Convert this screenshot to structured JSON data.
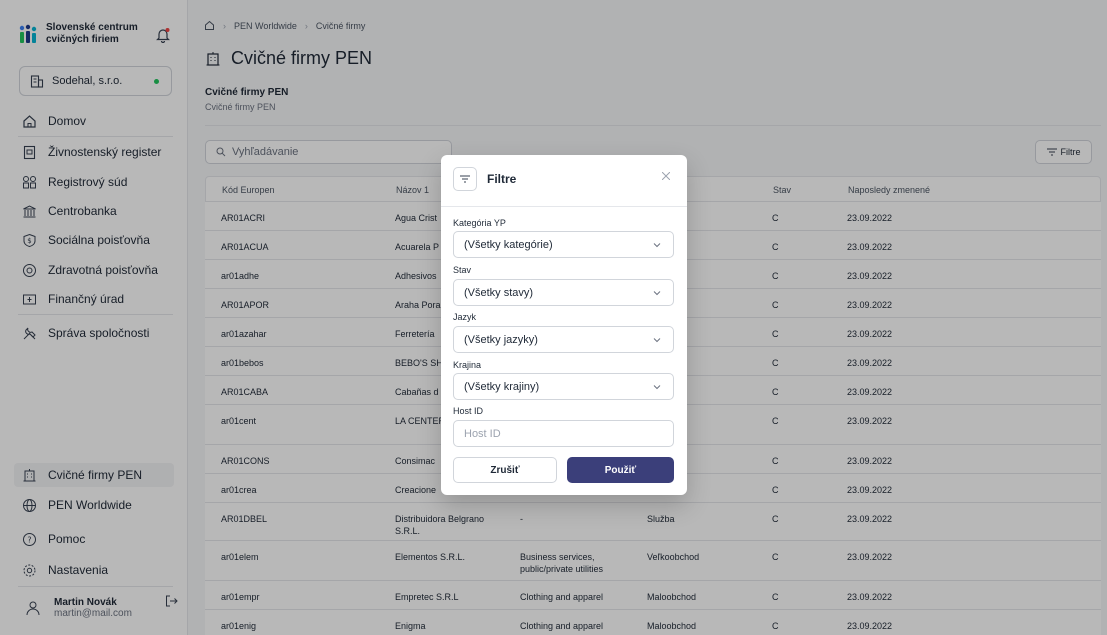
{
  "sidebar": {
    "brand": "Slovenské centrum cvičných firiem",
    "company": "Sodehal, s.r.o.",
    "nav": [
      {
        "label": "Domov",
        "icon": "home-icon"
      },
      {
        "label": "Živnostenský register",
        "icon": "register-icon"
      },
      {
        "label": "Registrový súd",
        "icon": "court-icon"
      },
      {
        "label": "Centrobanka",
        "icon": "bank-icon"
      },
      {
        "label": "Sociálna poisťovňa",
        "icon": "social-insurance-icon"
      },
      {
        "label": "Zdravotná poisťovňa",
        "icon": "health-insurance-icon"
      },
      {
        "label": "Finančný úrad",
        "icon": "tax-office-icon"
      },
      {
        "label": "Správa spoločnosti",
        "icon": "tools-icon"
      }
    ],
    "bottom": [
      {
        "label": "Cvičné firmy PEN",
        "icon": "building-icon"
      },
      {
        "label": "PEN Worldwide",
        "icon": "globe-icon"
      },
      {
        "label": "Pomoc",
        "icon": "help-icon"
      },
      {
        "label": "Nastavenia",
        "icon": "settings-icon"
      }
    ],
    "user": {
      "name": "Martin Novák",
      "email": "martin@mail.com"
    }
  },
  "breadcrumb": {
    "items": [
      "PEN Worldwide",
      "Cvičné firmy"
    ]
  },
  "page": {
    "title": "Cvičné firmy PEN",
    "subtitle": "Cvičné firmy PEN",
    "subtitle2": "Cvičné firmy PEN"
  },
  "toolbar": {
    "search_placeholder": "Vyhľadávanie",
    "filter_label": "Filtre"
  },
  "table": {
    "headers": [
      "Kód Europen",
      "Názov 1",
      "",
      "",
      "Stav",
      "Naposledy zmenené"
    ],
    "rows": [
      [
        "AR01ACRI",
        "Agua Crist",
        "",
        "",
        "C",
        "23.09.2022"
      ],
      [
        "AR01ACUA",
        "Acuarela P",
        "",
        "",
        "C",
        "23.09.2022"
      ],
      [
        "ar01adhe",
        "Adhesivos",
        "",
        "",
        "C",
        "23.09.2022"
      ],
      [
        "AR01APOR",
        "Araha Pora",
        "",
        "",
        "C",
        "23.09.2022"
      ],
      [
        "ar01azahar",
        "Ferretería",
        "",
        "",
        "C",
        "23.09.2022"
      ],
      [
        "ar01bebos",
        "BEBO'S SH",
        "",
        "hod",
        "C",
        "23.09.2022"
      ],
      [
        "AR01CABA",
        "Cabañas d",
        "",
        "",
        "C",
        "23.09.2022"
      ],
      [
        "ar01cent",
        "LA CENTER COOPERAT",
        "",
        "",
        "C",
        "23.09.2022"
      ],
      [
        "AR01CONS",
        "Consimac",
        "",
        "",
        "C",
        "23.09.2022"
      ],
      [
        "ar01crea",
        "Creacione",
        "",
        "",
        "C",
        "23.09.2022"
      ],
      [
        "AR01DBEL",
        "Distribuidora Belgrano S.R.L.",
        "-",
        "Služba",
        "C",
        "23.09.2022"
      ],
      [
        "ar01elem",
        "Elementos S.R.L.",
        "Business services, public/private utilities",
        "Veľkoobchod",
        "C",
        "23.09.2022"
      ],
      [
        "ar01empr",
        "Empretec S.R.L",
        "Clothing and apparel",
        "Maloobchod",
        "C",
        "23.09.2022"
      ],
      [
        "ar01enig",
        "Enigma",
        "Clothing and apparel",
        "Maloobchod",
        "C",
        "23.09.2022"
      ]
    ]
  },
  "modal": {
    "title": "Filtre",
    "fields": [
      {
        "label": "Kategória YP",
        "value": "(Všetky kategórie)"
      },
      {
        "label": "Stav",
        "value": "(Všetky stavy)"
      },
      {
        "label": "Jazyk",
        "value": "(Všetky jazyky)"
      },
      {
        "label": "Krajina",
        "value": "(Všetky krajiny)"
      }
    ],
    "host_label": "Host ID",
    "host_placeholder": "Host ID",
    "cancel": "Zrušiť",
    "apply": "Použiť"
  },
  "colors": {
    "accent": "#3b3f7a",
    "status_dot": "#22c55e"
  }
}
